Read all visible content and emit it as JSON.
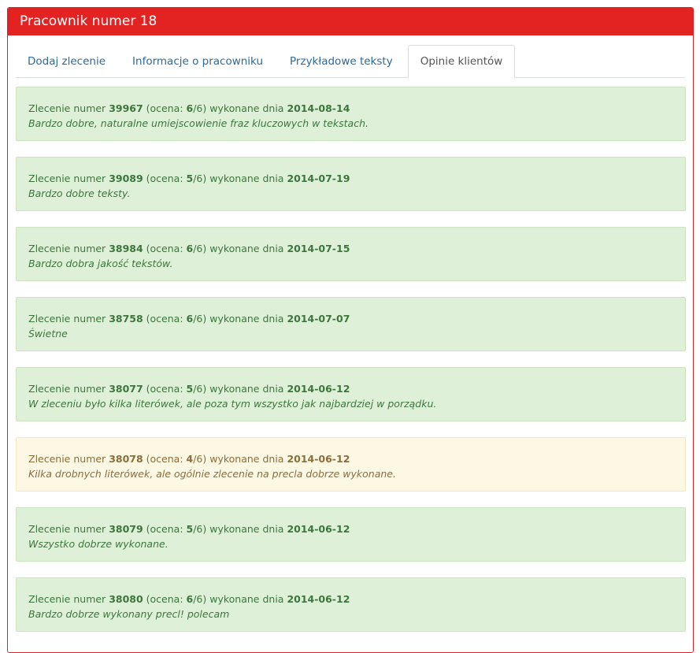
{
  "header": {
    "title": "Pracownik numer 18"
  },
  "tabs": [
    {
      "label": "Dodaj zlecenie"
    },
    {
      "label": "Informacje o pracowniku"
    },
    {
      "label": "Przykładowe teksty"
    },
    {
      "label": "Opinie klientów"
    }
  ],
  "labels": {
    "prefix": "Zlecenie numer ",
    "rating_open": " (ocena: ",
    "rating_max": "/6) wykonane dnia "
  },
  "reviews": [
    {
      "order": "39967",
      "rating": "6",
      "date": "2014-08-14",
      "comment": "Bardzo dobre, naturalne umiejscowienie fraz kluczowych w tekstach."
    },
    {
      "order": "39089",
      "rating": "5",
      "date": "2014-07-19",
      "comment": "Bardzo dobre teksty."
    },
    {
      "order": "38984",
      "rating": "6",
      "date": "2014-07-15",
      "comment": "Bardzo dobra jakość tekstów."
    },
    {
      "order": "38758",
      "rating": "6",
      "date": "2014-07-07",
      "comment": "Świetne"
    },
    {
      "order": "38077",
      "rating": "5",
      "date": "2014-06-12",
      "comment": "W zleceniu było kilka literówek, ale poza tym wszystko jak najbardziej w porządku."
    },
    {
      "order": "38078",
      "rating": "4",
      "date": "2014-06-12",
      "comment": "Kilka drobnych literówek, ale ogólnie zlecenie na precla dobrze wykonane."
    },
    {
      "order": "38079",
      "rating": "5",
      "date": "2014-06-12",
      "comment": "Wszystko dobrze wykonane."
    },
    {
      "order": "38080",
      "rating": "6",
      "date": "2014-06-12",
      "comment": "Bardzo dobrze wykonany precl! polecam"
    }
  ],
  "colors": {
    "header_bg": "#e32222",
    "success_bg": "#dff0d8",
    "success_text": "#3c763d",
    "warning_bg": "#fcf8e3",
    "warning_text": "#8a6d3b"
  }
}
